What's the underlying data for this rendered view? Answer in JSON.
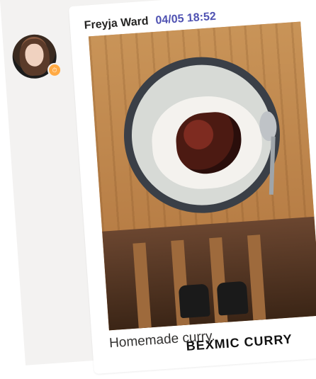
{
  "message": {
    "author": "Freyja Ward",
    "timestamp": "04/05 18:52",
    "caption": "Homemade curry.",
    "status": {
      "type": "away",
      "color": "#ffaa44",
      "icon": "clock-icon"
    }
  },
  "bottom_overlay_text": "BEXMIC CURRY",
  "colors": {
    "timestamp": "#4f52b2",
    "name": "#252423",
    "background": "#f3f2f1"
  }
}
